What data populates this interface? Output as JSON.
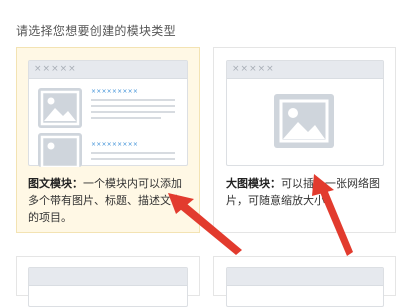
{
  "prompt": "请选择您想要创建的模块类型",
  "cards": [
    {
      "title": "图文模块：",
      "description": "一个模块内可以添加多个带有图片、标题、描述文字的项目。",
      "preview_dots": "×××××",
      "item_titles": [
        "×××××××××",
        "×××××××××"
      ],
      "selected": true
    },
    {
      "title": "大图模块：",
      "description": "可以插入一张网络图片，可随意缩放大小。",
      "preview_dots": "×××××",
      "selected": false
    }
  ],
  "colors": {
    "selected_bg": "#fff8e5",
    "link_blue": "#3b8fd7",
    "arrow_red": "#e23b2e"
  }
}
